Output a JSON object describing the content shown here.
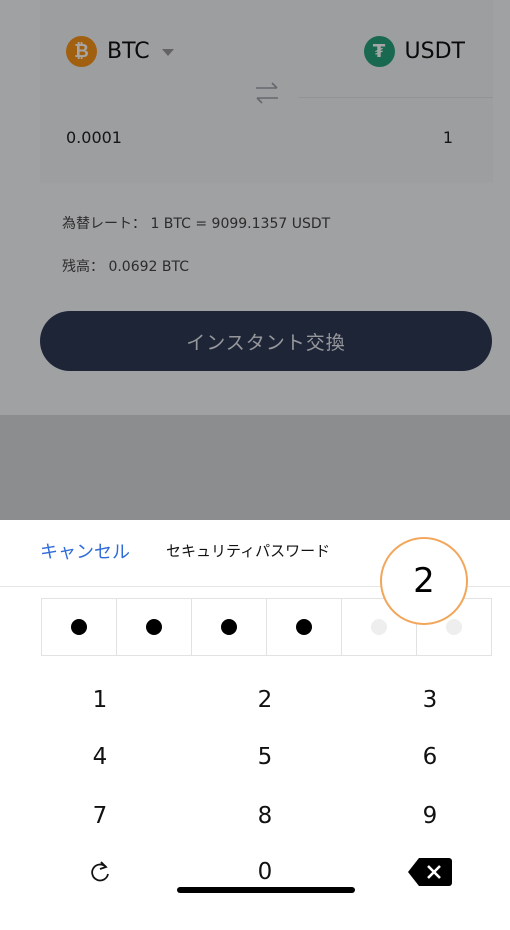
{
  "exchange": {
    "from_coin": "BTC",
    "to_coin": "USDT",
    "from_amount": "0.0001",
    "to_amount": "1",
    "rate_text": "為替レート：  1 BTC = 9099.1357 USDT",
    "balance_text": "残高：  0.0692 BTC",
    "exchange_button": "インスタント交換"
  },
  "password_sheet": {
    "cancel_label": "キャンセル",
    "title": "セキュリティパスワード",
    "filled_count": 4,
    "total_digits": 6
  },
  "annotation_label": "2",
  "keypad": {
    "keys": [
      "1",
      "2",
      "3",
      "4",
      "5",
      "6",
      "7",
      "8",
      "9",
      "0"
    ]
  },
  "icons": {
    "btc": "bitcoin-icon",
    "usdt": "tether-icon",
    "swap": "swap-arrows-icon",
    "refresh": "refresh-icon",
    "backspace": "backspace-icon"
  },
  "colors": {
    "accent_blue": "#2f6bd8",
    "button_dark": "#2e3a55",
    "btc_orange": "#f7931a",
    "usdt_green": "#26a17b",
    "annotation_orange": "#f2a65a"
  }
}
